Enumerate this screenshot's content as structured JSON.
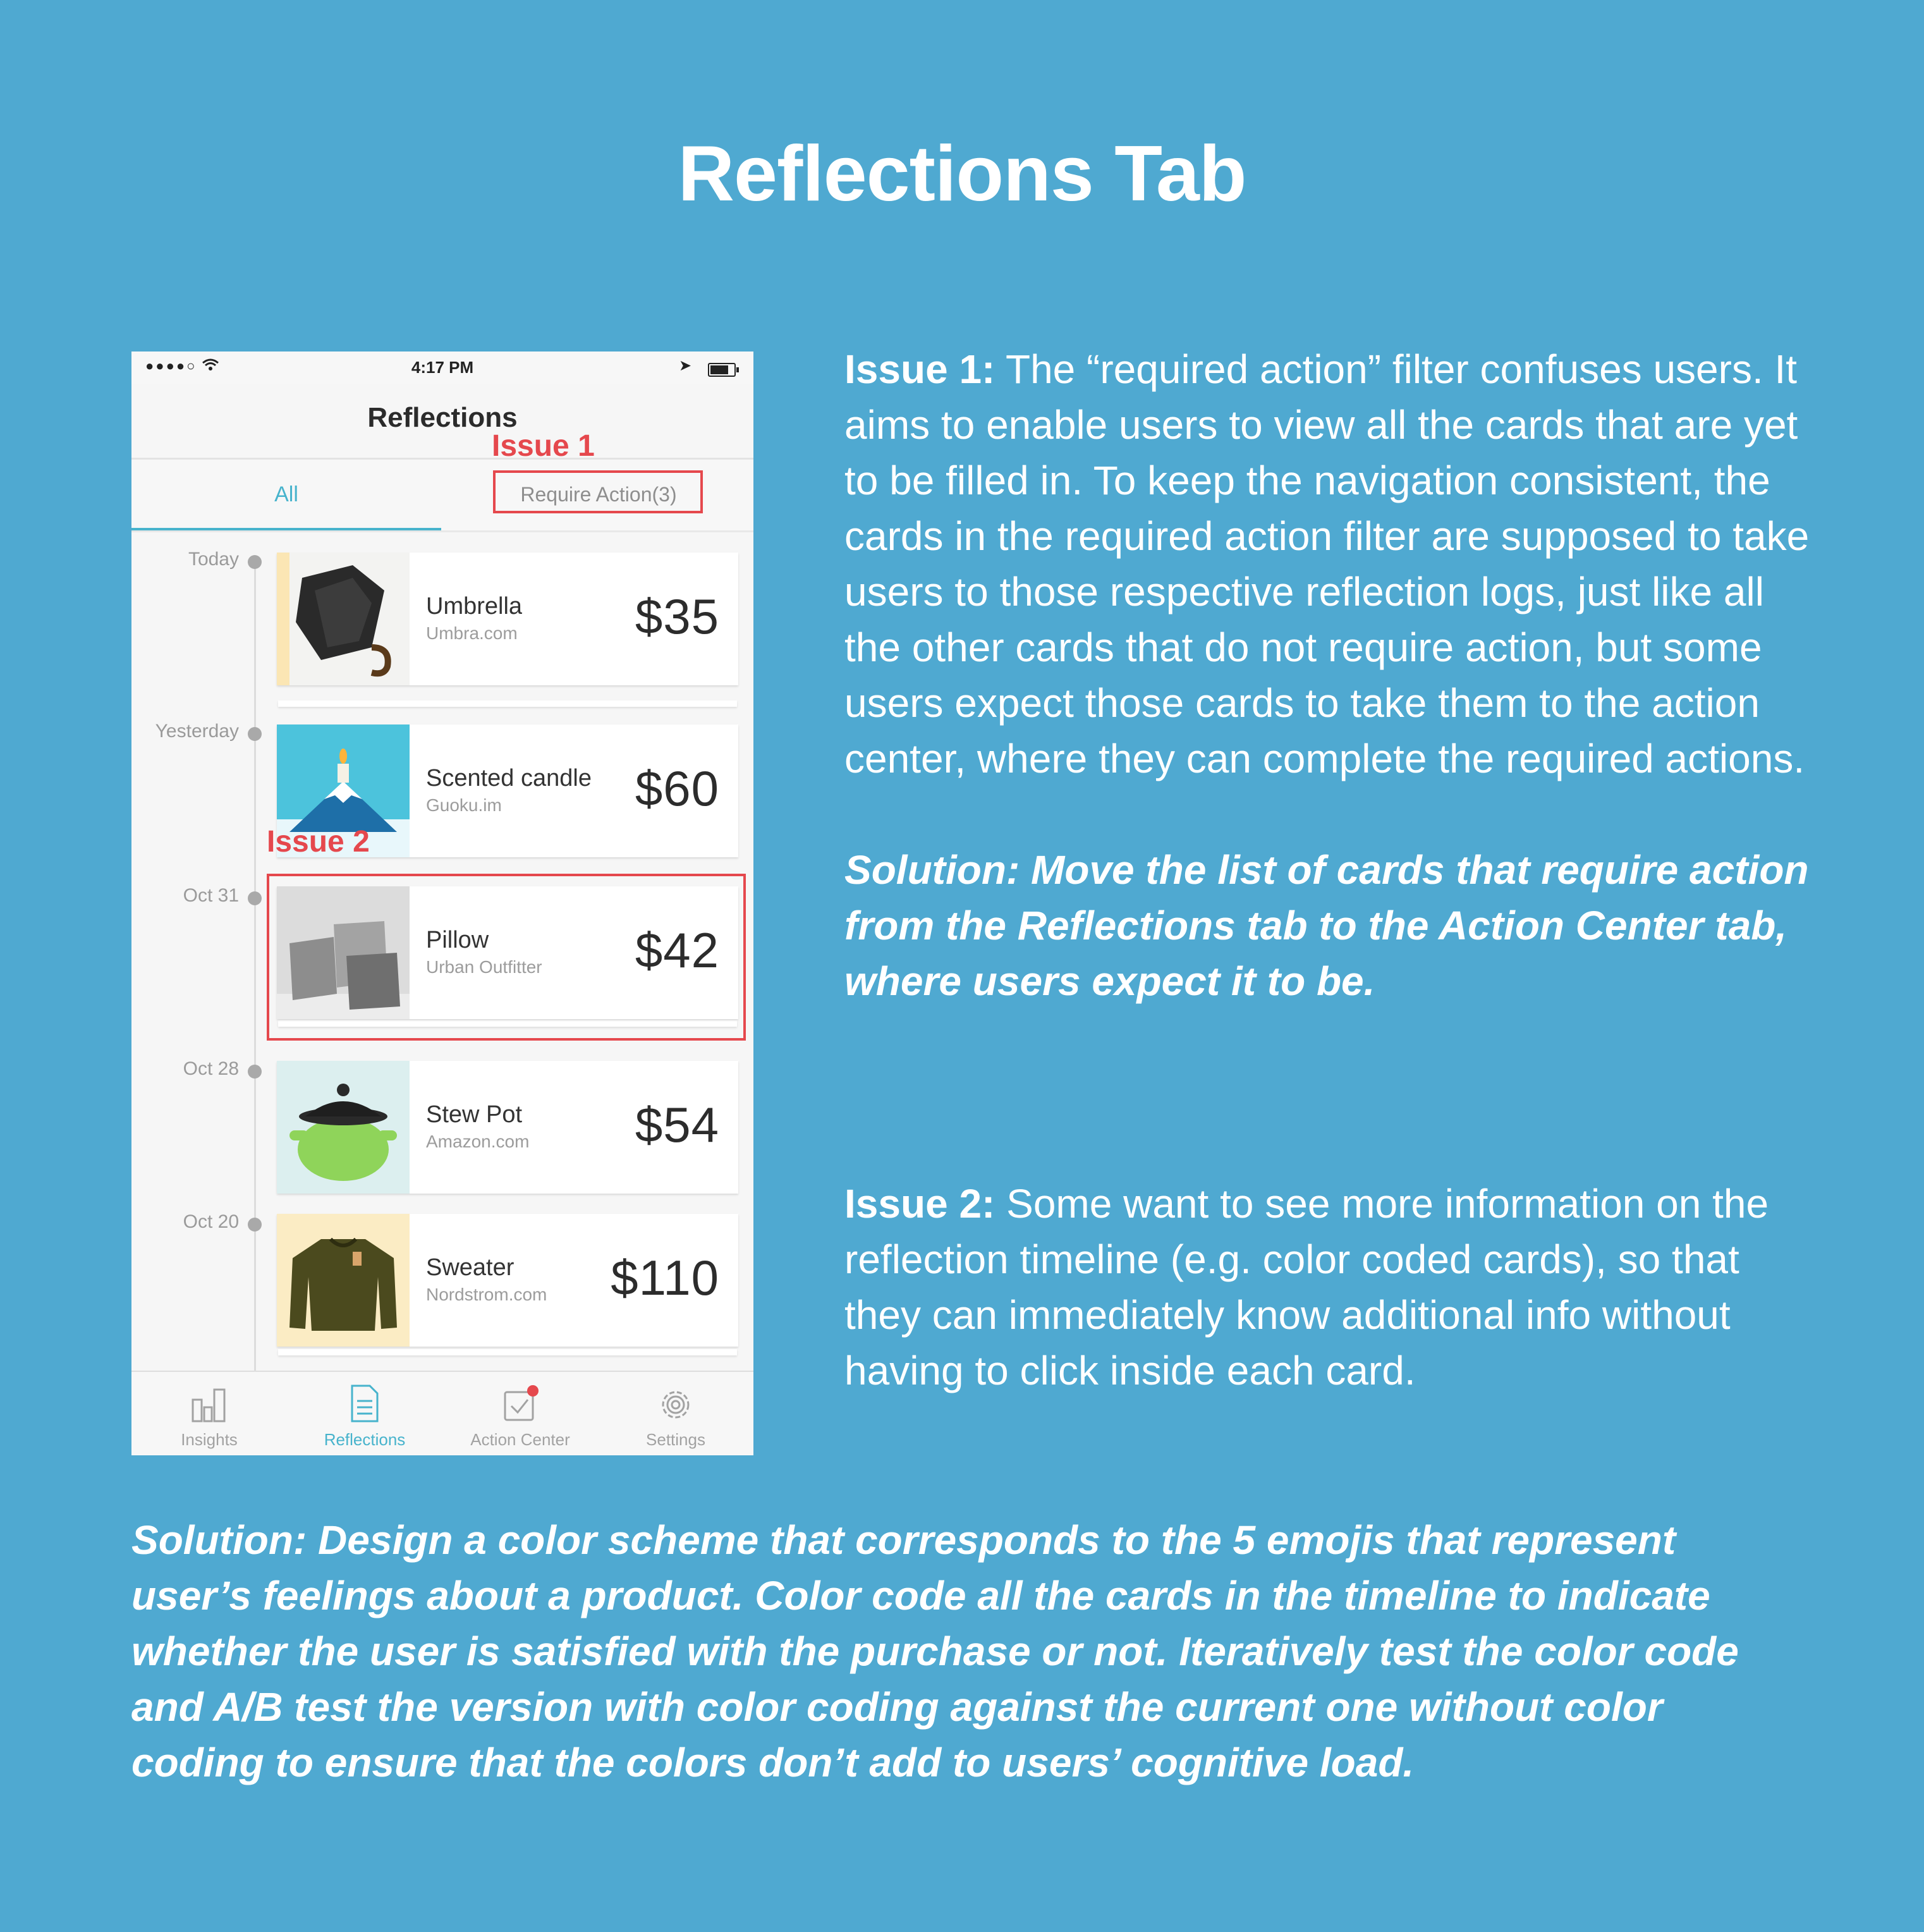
{
  "page_title": "Reflections Tab",
  "phone": {
    "status_bar": {
      "signal": "●●●●○",
      "time": "4:17 PM"
    },
    "nav_title": "Reflections",
    "tabs": {
      "all": "All",
      "require_action": "Require Action(3)"
    },
    "issue_labels": {
      "issue1": "Issue 1",
      "issue2": "Issue 2"
    },
    "cards": [
      {
        "date": "Today",
        "name": "Umbrella",
        "store": "Umbra.com",
        "price": "$35",
        "thumb_color": "#f3f3f1"
      },
      {
        "date": "Yesterday",
        "name": "Scented candle",
        "store": "Guoku.im",
        "price": "$60",
        "thumb_color": "#4cc3dc"
      },
      {
        "date": "Oct 31",
        "name": "Pillow",
        "store": "Urban Outfitter",
        "price": "$42",
        "thumb_color": "#dcdcdc"
      },
      {
        "date": "Oct 28",
        "name": "Stew Pot",
        "store": "Amazon.com",
        "price": "$54",
        "thumb_color": "#dcefef"
      },
      {
        "date": "Oct 20",
        "name": "Sweater",
        "store": "Nordstrom.com",
        "price": "$110",
        "thumb_color": "#fbecc4"
      }
    ],
    "tab_bar": [
      {
        "label": "Insights",
        "icon": "bar-chart-icon"
      },
      {
        "label": "Reflections",
        "icon": "document-icon"
      },
      {
        "label": "Action Center",
        "icon": "checkbox-icon"
      },
      {
        "label": "Settings",
        "icon": "gear-icon"
      }
    ],
    "accent_color": "#47b3cc",
    "issue_color": "#e5484d"
  },
  "issue1": {
    "label": "Issue 1:",
    "text": " The “required action” filter confuses users. It aims to enable users to view all the cards that are yet to be filled in. To keep the navigation consistent, the cards in the required action filter are supposed to take users to those respective reflection logs, just like all the other cards that do not require action, but some users expect those cards to take them to the action center, where they can complete the required actions.",
    "solution": "Solution: Move the list of cards that require action from the Reflections tab to the Action Center tab, where users expect it to be."
  },
  "issue2": {
    "label": "Issue 2:",
    "text": " Some want to see more information on the reflection timeline (e.g. color coded cards), so that they can immediately know additional info without having to click inside each card.",
    "solution": "Solution: Design a color scheme that corresponds to the 5 emojis that represent user’s feelings about a product. Color code all the cards in the timeline to indicate whether the user is satisfied with the purchase or not. Iteratively test the color code and A/B test the version with color coding against the current one without color coding to ensure that the colors don’t add to users’ cognitive load."
  },
  "background_color": "#4fa9d1"
}
